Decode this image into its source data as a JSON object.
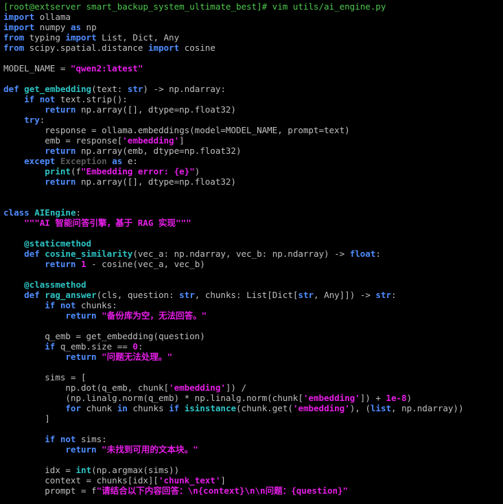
{
  "terminal": {
    "prompt": "[root@extserver smart_backup_system_ultimate_best]# vim utils/ai_engine.py"
  },
  "code": {
    "l2": [
      "import",
      " ollama"
    ],
    "l3": [
      "import",
      " numpy ",
      "as",
      " np"
    ],
    "l4": [
      "from",
      " typing ",
      "import",
      " List, Dict, Any"
    ],
    "l5": [
      "from",
      " scipy.spatial.distance ",
      "import",
      " cosine"
    ],
    "l7": [
      "MODEL_NAME = ",
      "\"qwen2:latest\""
    ],
    "l9": [
      "def",
      " ",
      "get_embedding",
      "(text: ",
      "str",
      ") -> np.ndarray:"
    ],
    "l10": [
      "    ",
      "if not",
      " text.strip():"
    ],
    "l11": [
      "        ",
      "return",
      " np.array([], dtype=np.float32)"
    ],
    "l12": [
      "    ",
      "try",
      ":"
    ],
    "l13": [
      "        response = ollama.embeddings(model=MODEL_NAME, prompt=text)"
    ],
    "l14": [
      "        emb = response[",
      "'embedding'",
      "]"
    ],
    "l15": [
      "        ",
      "return",
      " np.array(emb, dtype=np.float32)"
    ],
    "l16": [
      "    ",
      "except",
      " ",
      "Exception",
      " ",
      "as",
      " e:"
    ],
    "l17": [
      "        ",
      "print",
      "(f",
      "\"Embedding error: {e}\"",
      ")"
    ],
    "l18": [
      "        ",
      "return",
      " np.array([], dtype=np.float32)"
    ],
    "l21": [
      "class",
      " ",
      "AIEngine",
      ":"
    ],
    "l22": [
      "    ",
      "\"\"\"AI 智能问答引擎，基于 RAG 实现\"\"\""
    ],
    "l24": [
      "    ",
      "@staticmethod"
    ],
    "l25": [
      "    ",
      "def",
      " ",
      "cosine_similarity",
      "(vec_a: np.ndarray, vec_b: np.ndarray) -> ",
      "float",
      ":"
    ],
    "l26": [
      "        ",
      "return",
      " ",
      "1",
      " - cosine(vec_a, vec_b)"
    ],
    "l28": [
      "    ",
      "@classmethod"
    ],
    "l29": [
      "    ",
      "def",
      " ",
      "rag_answer",
      "(cls, question: ",
      "str",
      ", chunks: List[Dict[",
      "str",
      ", Any]]) -> ",
      "str",
      ":"
    ],
    "l30": [
      "        ",
      "if not",
      " chunks:"
    ],
    "l31": [
      "            ",
      "return",
      " ",
      "\"备份库为空，无法回答。\""
    ],
    "l33": [
      "        q_emb = get_embedding(question)"
    ],
    "l34": [
      "        ",
      "if",
      " q_emb.size == ",
      "0",
      ":"
    ],
    "l35": [
      "            ",
      "return",
      " ",
      "\"问题无法处理。\""
    ],
    "l37": [
      "        sims = ["
    ],
    "l38": [
      "            np.dot(q_emb, chunk[",
      "'embedding'",
      "]) /"
    ],
    "l39": [
      "            (np.linalg.norm(q_emb) * np.linalg.norm(chunk[",
      "'embedding'",
      "]) + ",
      "1e-8",
      ")"
    ],
    "l40": [
      "            ",
      "for",
      " chunk ",
      "in",
      " chunks ",
      "if",
      " ",
      "isinstance",
      "(chunk.get(",
      "'embedding'",
      "), (",
      "list",
      ", np.ndarray))"
    ],
    "l41": [
      "        ]"
    ],
    "l43": [
      "        ",
      "if not",
      " sims:"
    ],
    "l44": [
      "            ",
      "return",
      " ",
      "\"未找到可用的文本块。\""
    ],
    "l46": [
      "        idx = ",
      "int",
      "(np.argmax(sims))"
    ],
    "l47": [
      "        context = chunks[idx][",
      "'chunk_text'",
      "]"
    ],
    "l48": [
      "        prompt = f",
      "\"请结合以下内容回答：",
      "\\n",
      "{context}",
      "\\n\\n",
      "问题：",
      "{question}",
      "\""
    ]
  }
}
